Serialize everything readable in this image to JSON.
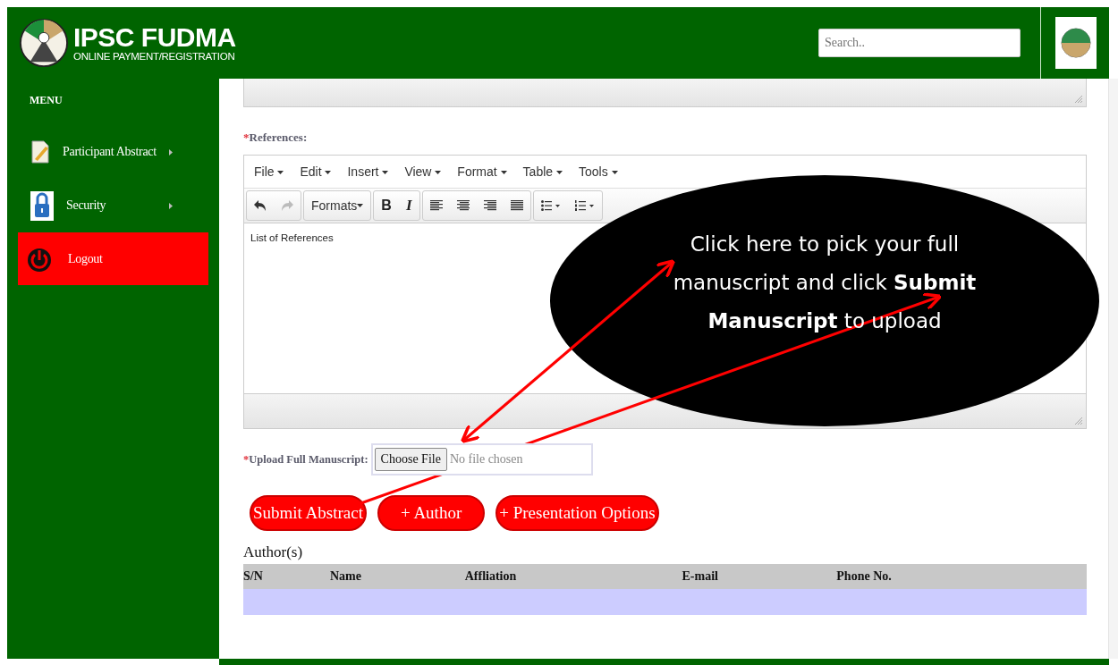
{
  "header": {
    "title": "IPSC FUDMA",
    "subtitle": "ONLINE PAYMENT/REGISTRATION",
    "search": {
      "placeholder": "Search.."
    }
  },
  "sidebar": {
    "heading": "MENU",
    "items": [
      {
        "label": "Participant Abstract",
        "kind": "document",
        "submenu": true
      },
      {
        "label": "Security",
        "kind": "lock",
        "submenu": true
      },
      {
        "label": "Logout",
        "kind": "power",
        "submenu": false
      }
    ]
  },
  "references": {
    "label": "References:",
    "required_mark": "*",
    "menubar": [
      "File",
      "Edit",
      "Insert",
      "View",
      "Format",
      "Table",
      "Tools"
    ],
    "formats": "Formats",
    "bold": "B",
    "italic": "I",
    "content": "List of References"
  },
  "upload": {
    "required_mark": "*",
    "label": "Upload Full Manuscript:",
    "button": "Choose File",
    "status": "No file chosen"
  },
  "buttons": [
    "Submit Abstract",
    "+ Author",
    "+ Presentation Options"
  ],
  "authors": {
    "title": "Author(s)",
    "columns": [
      "S/N",
      "Name",
      "Affliation",
      "E-mail",
      "Phone No."
    ]
  },
  "callout": {
    "text": "Click here to pick your full manuscript and click **Submit Manuscript** to upload"
  }
}
